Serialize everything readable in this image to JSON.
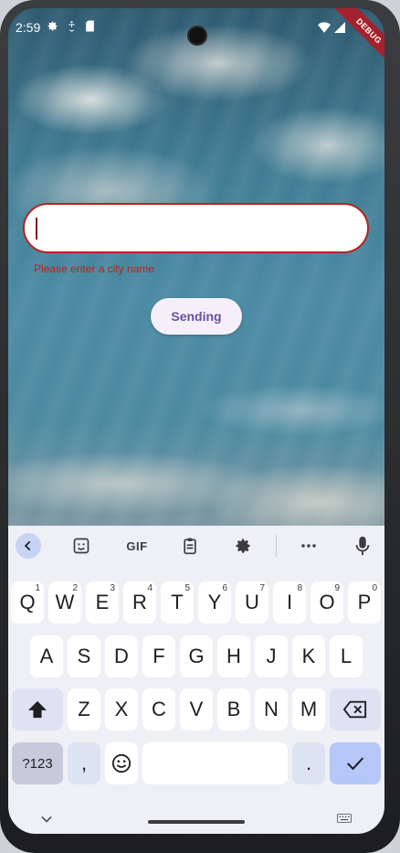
{
  "status_bar": {
    "time": "2:59",
    "icons": [
      "gear-icon",
      "accessibility-icon",
      "sd-card-icon",
      "wifi-icon",
      "signal-icon"
    ]
  },
  "debug_banner": "DEBUG",
  "form": {
    "city_input_value": "",
    "error_text": "Please enter a city name",
    "send_button_label": "Sending",
    "accent_error": "#b3261e",
    "accent_primary": "#6750a4"
  },
  "keyboard": {
    "toolbar": {
      "gif_label": "GIF",
      "icons": [
        "back-icon",
        "sticker-icon",
        "gif-icon",
        "clipboard-icon",
        "settings-icon",
        "more-icon",
        "microphone-icon"
      ]
    },
    "row1": [
      {
        "label": "Q",
        "hint": "1"
      },
      {
        "label": "W",
        "hint": "2"
      },
      {
        "label": "E",
        "hint": "3"
      },
      {
        "label": "R",
        "hint": "4"
      },
      {
        "label": "T",
        "hint": "5"
      },
      {
        "label": "Y",
        "hint": "6"
      },
      {
        "label": "U",
        "hint": "7"
      },
      {
        "label": "I",
        "hint": "8"
      },
      {
        "label": "O",
        "hint": "9"
      },
      {
        "label": "P",
        "hint": "0"
      }
    ],
    "row2": [
      "A",
      "S",
      "D",
      "F",
      "G",
      "H",
      "J",
      "K",
      "L"
    ],
    "row3": [
      "Z",
      "X",
      "C",
      "V",
      "B",
      "N",
      "M"
    ],
    "row4": {
      "symbols_label": "?123",
      "comma_label": ",",
      "period_label": "."
    }
  }
}
